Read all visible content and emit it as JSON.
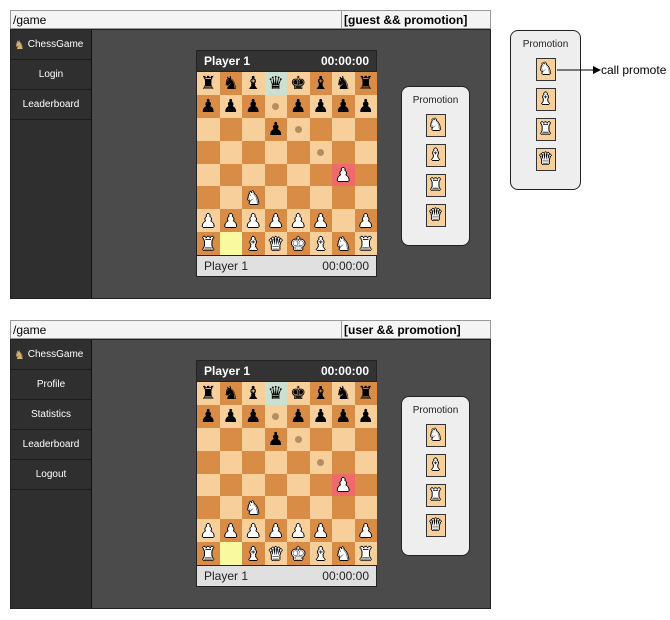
{
  "screens": [
    {
      "url_path": "/game",
      "state_label": "[guest && promotion]",
      "brand_label": "ChessGame",
      "nav": [
        "Login",
        "Leaderboard"
      ],
      "top_player": {
        "name": "Player 1",
        "time": "00:00:00"
      },
      "bottom_player": {
        "name": "Player 1",
        "time": "00:00:00"
      },
      "promotion_title": "Promotion"
    },
    {
      "url_path": "/game",
      "state_label": "[user && promotion]",
      "brand_label": "ChessGame",
      "nav": [
        "Profile",
        "Statistics",
        "Leaderboard",
        "Logout"
      ],
      "top_player": {
        "name": "Player 1",
        "time": "00:00:00"
      },
      "bottom_player": {
        "name": "Player 1",
        "time": "00:00:00"
      },
      "promotion_title": "Promotion"
    }
  ],
  "detail_popup": {
    "title": "Promotion",
    "annotation": "call promote"
  },
  "board": [
    [
      "bR",
      "bN",
      "bB",
      "bQ",
      "bK",
      "bB",
      "bN",
      "bR"
    ],
    [
      "bP",
      "bP",
      "bP",
      "dot",
      "bP",
      "bP",
      "bP",
      "bP"
    ],
    [
      "",
      "",
      "",
      "bP",
      "dot",
      "",
      "",
      ""
    ],
    [
      "",
      "",
      "",
      "",
      "",
      "dot",
      "",
      ""
    ],
    [
      "",
      "",
      "",
      "",
      "",
      "",
      "wP",
      ""
    ],
    [
      "",
      "",
      "wN",
      "",
      "",
      "",
      "",
      ""
    ],
    [
      "wP",
      "wP",
      "wP",
      "wP",
      "wP",
      "wP",
      "",
      "wP"
    ],
    [
      "wR",
      "",
      "wB",
      "wQ",
      "wK",
      "wB",
      "wN",
      "wR"
    ]
  ],
  "highlights": {
    "sel_light": "0,3",
    "yellow": "7,1",
    "red": "4,6"
  },
  "promotion_pieces": [
    "knight-icon",
    "bishop-icon",
    "rook-icon",
    "queen-icon"
  ],
  "colors": {
    "light": "#f7cf9b",
    "dark": "#d88c45",
    "sidebar": "#2f2f2f",
    "app_bg": "#4b4b4b"
  }
}
